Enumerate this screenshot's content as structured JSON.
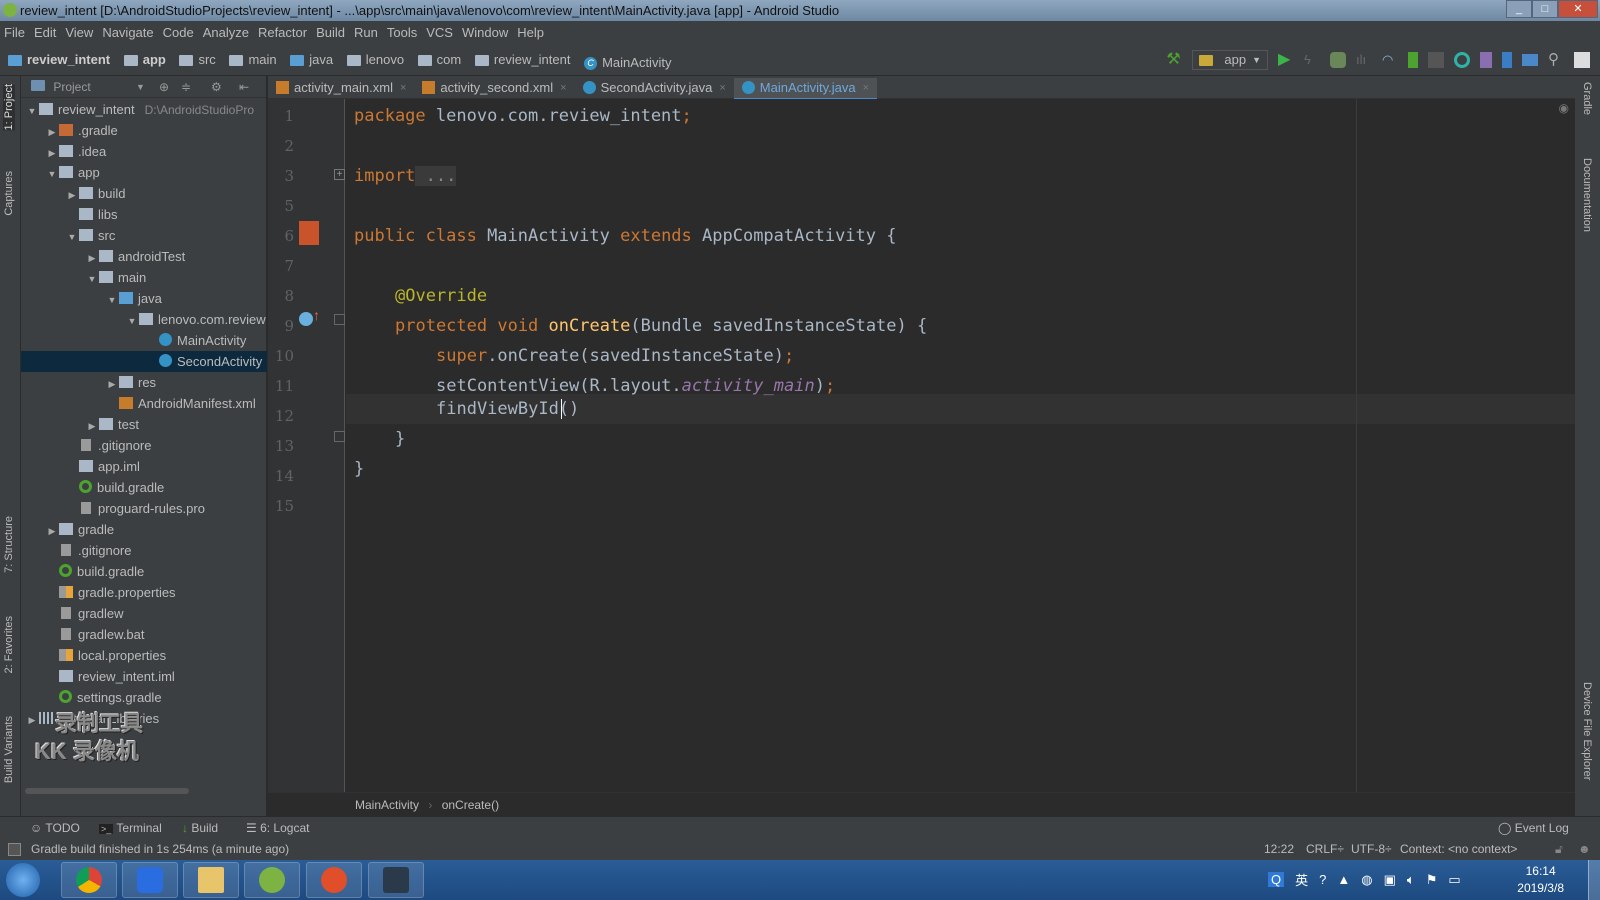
{
  "window": {
    "title": "review_intent [D:\\AndroidStudioProjects\\review_intent] - ...\\app\\src\\main\\java\\lenovo\\com\\review_intent\\MainActivity.java [app] - Android Studio"
  },
  "menu": [
    "File",
    "Edit",
    "View",
    "Navigate",
    "Code",
    "Analyze",
    "Refactor",
    "Build",
    "Run",
    "Tools",
    "VCS",
    "Window",
    "Help"
  ],
  "breadcrumbs": [
    "review_intent",
    "app",
    "src",
    "main",
    "java",
    "lenovo",
    "com",
    "review_intent",
    "MainActivity"
  ],
  "toolbar": {
    "run_config": "app",
    "icons": [
      "hammer-icon",
      "run-icon",
      "apply-changes-icon",
      "debug-icon",
      "profile-icon",
      "attach-debugger-icon",
      "stop-icon",
      "sync-gradle-icon",
      "avd-manager-icon",
      "sdk-manager-icon",
      "project-structure-icon",
      "search-icon",
      "user-icon"
    ]
  },
  "left_stripe": {
    "project": "1: Project",
    "captures": "Captures",
    "structure": "7: Structure",
    "favorites": "2: Favorites",
    "build_variants": "Build Variants"
  },
  "right_stripe": {
    "gradle": "Gradle",
    "documentation": "Documentation",
    "device_file_explorer": "Device File Explorer"
  },
  "project_panel": {
    "view": "Project",
    "tree": [
      {
        "label": "review_intent",
        "hint": "D:\\AndroidStudioPro",
        "depth": 0,
        "arrow": "open",
        "icon": "folder"
      },
      {
        "label": ".gradle",
        "depth": 1,
        "arrow": "closed",
        "icon": "folderorange"
      },
      {
        "label": ".idea",
        "depth": 1,
        "arrow": "closed",
        "icon": "folder"
      },
      {
        "label": "app",
        "depth": 1,
        "arrow": "open",
        "icon": "folder"
      },
      {
        "label": "build",
        "depth": 2,
        "arrow": "closed",
        "icon": "folder"
      },
      {
        "label": "libs",
        "depth": 2,
        "arrow": "",
        "icon": "folder"
      },
      {
        "label": "src",
        "depth": 2,
        "arrow": "open",
        "icon": "folder"
      },
      {
        "label": "androidTest",
        "depth": 3,
        "arrow": "closed",
        "icon": "folder"
      },
      {
        "label": "main",
        "depth": 3,
        "arrow": "open",
        "icon": "folder"
      },
      {
        "label": "java",
        "depth": 4,
        "arrow": "open",
        "icon": "folderblue"
      },
      {
        "label": "lenovo.com.review",
        "depth": 5,
        "arrow": "open",
        "icon": "folder"
      },
      {
        "label": "MainActivity",
        "depth": 6,
        "arrow": "",
        "icon": "classc"
      },
      {
        "label": "SecondActivity",
        "depth": 6,
        "arrow": "",
        "icon": "classc",
        "selected": true
      },
      {
        "label": "res",
        "depth": 4,
        "arrow": "closed",
        "icon": "folder"
      },
      {
        "label": "AndroidManifest.xml",
        "depth": 4,
        "arrow": "",
        "icon": "xml"
      },
      {
        "label": "test",
        "depth": 3,
        "arrow": "closed",
        "icon": "folder"
      },
      {
        "label": ".gitignore",
        "depth": 2,
        "arrow": "",
        "icon": "file"
      },
      {
        "label": "app.iml",
        "depth": 2,
        "arrow": "",
        "icon": "folder"
      },
      {
        "label": "build.gradle",
        "depth": 2,
        "arrow": "",
        "icon": "gradle"
      },
      {
        "label": "proguard-rules.pro",
        "depth": 2,
        "arrow": "",
        "icon": "file"
      },
      {
        "label": "gradle",
        "depth": 1,
        "arrow": "closed",
        "icon": "folder"
      },
      {
        "label": ".gitignore",
        "depth": 1,
        "arrow": "",
        "icon": "file"
      },
      {
        "label": "build.gradle",
        "depth": 1,
        "arrow": "",
        "icon": "gradle"
      },
      {
        "label": "gradle.properties",
        "depth": 1,
        "arrow": "",
        "icon": "props"
      },
      {
        "label": "gradlew",
        "depth": 1,
        "arrow": "",
        "icon": "file"
      },
      {
        "label": "gradlew.bat",
        "depth": 1,
        "arrow": "",
        "icon": "file"
      },
      {
        "label": "local.properties",
        "depth": 1,
        "arrow": "",
        "icon": "props"
      },
      {
        "label": "review_intent.iml",
        "depth": 1,
        "arrow": "",
        "icon": "folder"
      },
      {
        "label": "settings.gradle",
        "depth": 1,
        "arrow": "",
        "icon": "gradle"
      },
      {
        "label": "External Libraries",
        "depth": 0,
        "arrow": "closed",
        "icon": "lib"
      }
    ]
  },
  "tabs": [
    {
      "label": "activity_main.xml",
      "icon": "xml"
    },
    {
      "label": "activity_second.xml",
      "icon": "xml"
    },
    {
      "label": "SecondActivity.java",
      "icon": "class"
    },
    {
      "label": "MainActivity.java",
      "icon": "class",
      "active": true
    }
  ],
  "editor": {
    "line_numbers": [
      "1",
      "2",
      "3",
      "5",
      "6",
      "7",
      "8",
      "9",
      "10",
      "11",
      "12",
      "13",
      "14",
      "15"
    ],
    "code": {
      "l1_kw": "package",
      "l1_rest": " lenovo.com.review_intent",
      "l1_semi": ";",
      "l3_kw": "import",
      "l3_fold": " ...",
      "l6_kw1": "public class",
      "l6_name": " MainActivity ",
      "l6_kw2": "extends",
      "l6_rest": " AppCompatActivity {",
      "l8_ann": "@Override",
      "l9_kw": "protected void ",
      "l9_fn": "onCreate",
      "l9_rest": "(Bundle savedInstanceState) {",
      "l10_kw": "super",
      "l10_rest": ".onCreate(savedInstanceState)",
      "l10_semi": ";",
      "l11_a": "setContentView(R.layout.",
      "l11_it": "activity_main",
      "l11_b": ")",
      "l11_semi": ";",
      "l12": "findViewById()",
      "l13": "}",
      "l14": "}"
    },
    "breadcrumb": [
      "MainActivity",
      "onCreate()"
    ]
  },
  "bottom_tabs": [
    "TODO",
    "Terminal",
    "Build",
    "6: Logcat",
    "Event Log"
  ],
  "status": {
    "message": "Gradle build finished in 1s 254ms (a minute ago)",
    "position": "12:22",
    "line_sep": "CRLF÷",
    "encoding": "UTF-8÷",
    "context": "Context: <no context>"
  },
  "taskbar": {
    "ime": "英",
    "time": "16:14",
    "date": "2019/3/8",
    "apps": [
      "chrome",
      "wps",
      "explorer",
      "android-studio",
      "kk-recorder",
      "nox"
    ]
  },
  "watermark": {
    "line1": "录制工具",
    "line2": "KK 录像机"
  }
}
